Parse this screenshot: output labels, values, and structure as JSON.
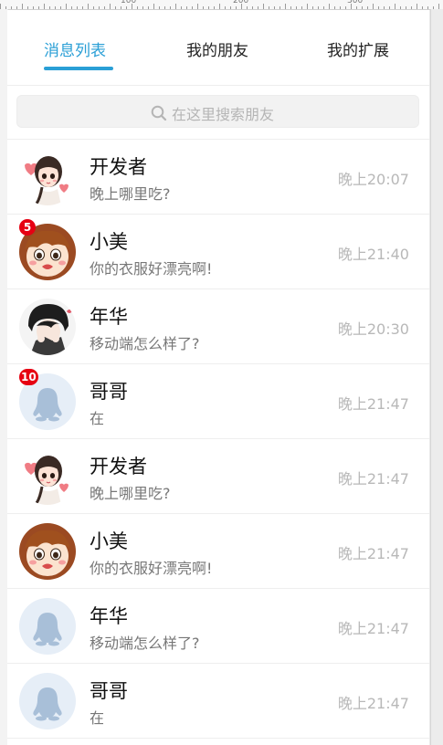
{
  "ruler": {
    "labels": [
      "100",
      "200",
      "300"
    ]
  },
  "tabs": [
    {
      "label": "消息列表",
      "active": true
    },
    {
      "label": "我的朋友",
      "active": false
    },
    {
      "label": "我的扩展",
      "active": false
    }
  ],
  "search": {
    "placeholder": "在这里搜索朋友"
  },
  "conversations": [
    {
      "name": "开发者",
      "message": "晚上哪里吃?",
      "time": "晚上20:07",
      "badge": "",
      "avatar": "girl-avatar"
    },
    {
      "name": "小美",
      "message": "你的衣服好漂亮啊!",
      "time": "晚上21:40",
      "badge": "5",
      "avatar": "boy-avatar"
    },
    {
      "name": "年华",
      "message": "移动端怎么样了?",
      "time": "晚上20:30",
      "badge": "",
      "avatar": "dark-hair-avatar"
    },
    {
      "name": "哥哥",
      "message": "在",
      "time": "晚上21:47",
      "badge": "10",
      "avatar": "default-penguin-avatar"
    },
    {
      "name": "开发者",
      "message": "晚上哪里吃?",
      "time": "晚上21:47",
      "badge": "",
      "avatar": "girl-avatar"
    },
    {
      "name": "小美",
      "message": "你的衣服好漂亮啊!",
      "time": "晚上21:47",
      "badge": "",
      "avatar": "boy-avatar"
    },
    {
      "name": "年华",
      "message": "移动端怎么样了?",
      "time": "晚上21:47",
      "badge": "",
      "avatar": "default-penguin-avatar"
    },
    {
      "name": "哥哥",
      "message": "在",
      "time": "晚上21:47",
      "badge": "",
      "avatar": "default-penguin-avatar"
    }
  ],
  "colors": {
    "accent": "#2a9fd6",
    "badge": "#e60012"
  }
}
